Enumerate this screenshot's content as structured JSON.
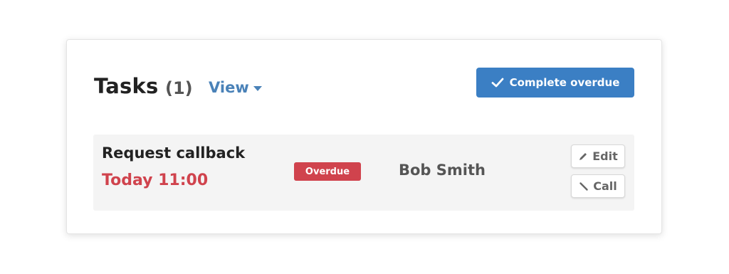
{
  "header": {
    "title": "Tasks",
    "count": "(1)",
    "view_label": "View",
    "complete_label": "Complete overdue"
  },
  "tasks": [
    {
      "title": "Request callback",
      "due": "Today 11:00",
      "status": "Overdue",
      "assignee": "Bob Smith",
      "edit_label": "Edit",
      "call_label": "Call"
    }
  ],
  "colors": {
    "accent": "#3b7fc4",
    "link": "#4a82b8",
    "overdue": "#d0434d",
    "row_bg": "#f4f4f4"
  },
  "icons": {
    "complete": "check-icon",
    "view": "caret-down-icon",
    "edit": "pencil-icon",
    "call": "phone-icon"
  }
}
